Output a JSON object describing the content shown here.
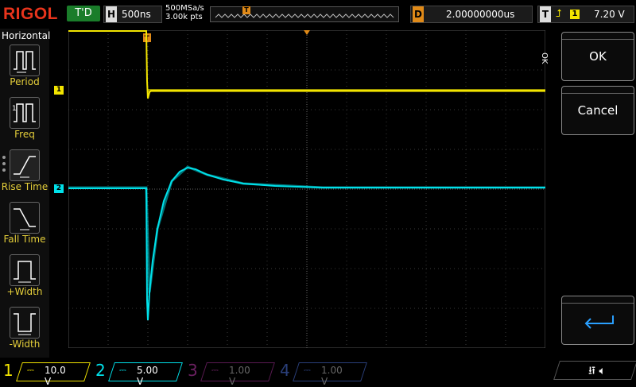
{
  "brand": "RIGOL",
  "run_status": "T'D",
  "horizontal": {
    "key": "H",
    "timebase": "500ns"
  },
  "sample": {
    "rate": "500MSa/s",
    "points": "3.00k pts"
  },
  "memory_marker": "T",
  "delay": {
    "key": "D",
    "value": "2.00000000us"
  },
  "trigger": {
    "key": "T",
    "source": "1",
    "level": "7.20 V"
  },
  "left_menu": {
    "title": "Horizontal",
    "items": [
      {
        "label": "Period"
      },
      {
        "label": "Freq"
      },
      {
        "label": "Rise Time"
      },
      {
        "label": "Fall Time"
      },
      {
        "label": "+Width"
      },
      {
        "label": "-Width"
      }
    ]
  },
  "right_panel": {
    "side_label": "OK",
    "ok_label": "OK",
    "cancel_label": "Cancel"
  },
  "channels": [
    {
      "num": "1",
      "scale": "10.0 V",
      "color": "#f2e400"
    },
    {
      "num": "2",
      "scale": "5.00 V",
      "color": "#00e1ea"
    },
    {
      "num": "3",
      "scale": "1.00 V",
      "color": "#e000c8"
    },
    {
      "num": "4",
      "scale": "1.00 V",
      "color": "#3c6fe8"
    }
  ],
  "ch_marker_1": "1",
  "ch_marker_2": "2",
  "trigger_marker": "T"
}
